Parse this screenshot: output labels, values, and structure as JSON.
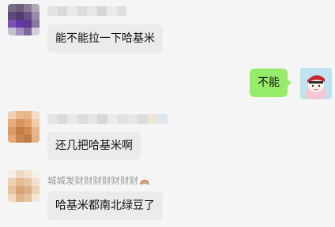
{
  "messages": [
    {
      "side": "in",
      "sender": "",
      "text": "能不能拉一下哈基米"
    },
    {
      "side": "out",
      "text": "不能"
    },
    {
      "side": "in",
      "sender": "",
      "text": "还几把哈基米啊"
    },
    {
      "side": "in",
      "sender": "城城发财财财财财财财",
      "text": "哈基米都南北绿豆了"
    }
  ],
  "colors": {
    "background": "#f5f5f5",
    "incoming_bubble": "#ebebeb",
    "outgoing_bubble": "#95ec69"
  },
  "icons": {
    "sender_badge": "rainbow-icon"
  }
}
